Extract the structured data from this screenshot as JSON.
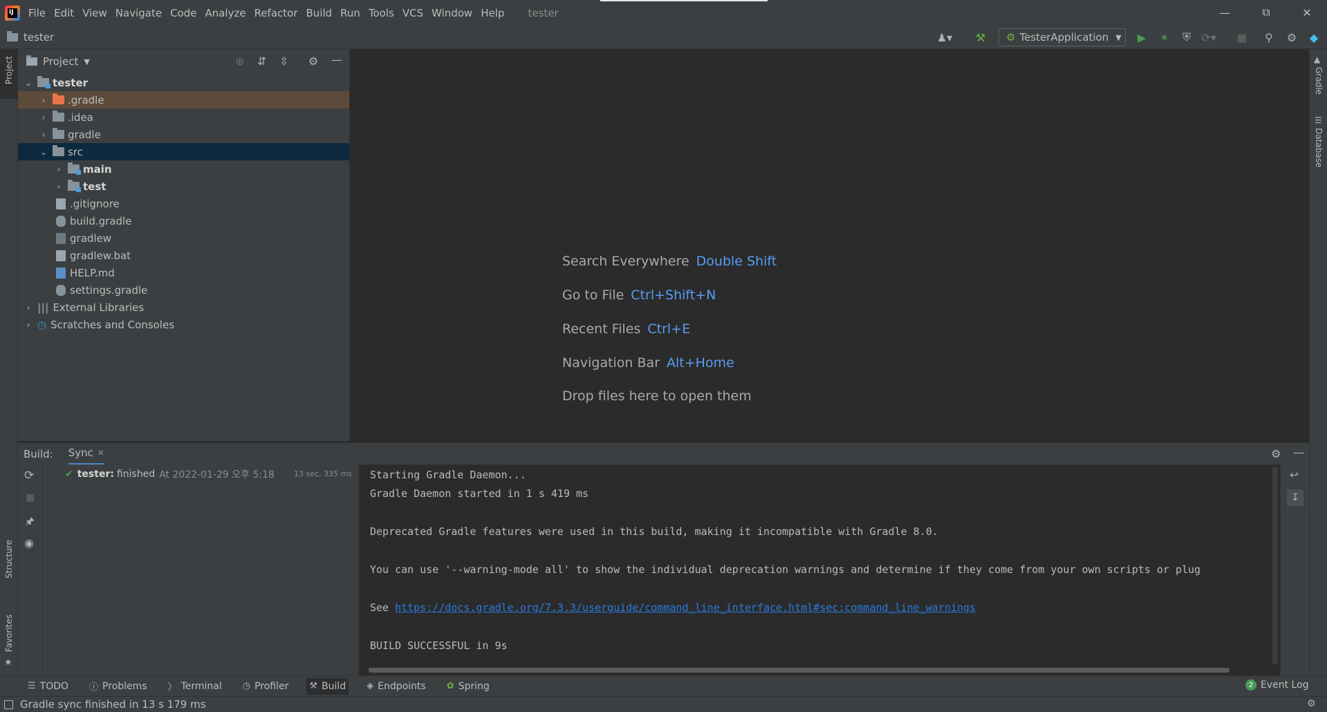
{
  "menubar": {
    "logo_text": "IJ",
    "items": [
      "File",
      "Edit",
      "View",
      "Navigate",
      "Code",
      "Analyze",
      "Refactor",
      "Build",
      "Run",
      "Tools",
      "VCS",
      "Window",
      "Help"
    ],
    "window_title": "tester",
    "window_controls": [
      "minimize-icon",
      "restore-icon",
      "close-icon"
    ]
  },
  "navbar": {
    "breadcrumb": "tester",
    "run_config": "TesterApplication",
    "icons": [
      "user-icon",
      "build-hammer-icon",
      "run-icon",
      "debug-icon",
      "coverage-icon",
      "profile-icon",
      "stop-icon",
      "search-icon",
      "settings-gear-icon",
      "jetbrains-toolbox-icon"
    ]
  },
  "left_stripe": {
    "project": "Project",
    "structure": "Structure",
    "favorites": "Favorites"
  },
  "right_stripe": {
    "gradle": "Gradle",
    "database": "Database"
  },
  "project_panel": {
    "title": "Project",
    "tree": [
      {
        "label": "tester",
        "level": 0,
        "type": "module",
        "expanded": true
      },
      {
        "label": ".gradle",
        "level": 1,
        "type": "folder-orange",
        "expanded": false
      },
      {
        "label": ".idea",
        "level": 1,
        "type": "folder",
        "expanded": false
      },
      {
        "label": "gradle",
        "level": 1,
        "type": "folder",
        "expanded": false
      },
      {
        "label": "src",
        "level": 1,
        "type": "folder",
        "expanded": true
      },
      {
        "label": "main",
        "level": 2,
        "type": "folder-source",
        "expanded": false
      },
      {
        "label": "test",
        "level": 2,
        "type": "folder-source",
        "expanded": false
      },
      {
        "label": ".gitignore",
        "level": 1,
        "type": "file"
      },
      {
        "label": "build.gradle",
        "level": 1,
        "type": "file-gradle"
      },
      {
        "label": "gradlew",
        "level": 1,
        "type": "file-shell"
      },
      {
        "label": "gradlew.bat",
        "level": 1,
        "type": "file"
      },
      {
        "label": "HELP.md",
        "level": 1,
        "type": "file-md"
      },
      {
        "label": "settings.gradle",
        "level": 1,
        "type": "file-gradle"
      },
      {
        "label": "External Libraries",
        "level": 0,
        "type": "libraries",
        "expanded": false
      },
      {
        "label": "Scratches and Consoles",
        "level": 0,
        "type": "scratches",
        "expanded": false
      }
    ]
  },
  "editor_hints": [
    {
      "text": "Search Everywhere",
      "shortcut": "Double Shift"
    },
    {
      "text": "Go to File",
      "shortcut": "Ctrl+Shift+N"
    },
    {
      "text": "Recent Files",
      "shortcut": "Ctrl+E"
    },
    {
      "text": "Navigation Bar",
      "shortcut": "Alt+Home"
    },
    {
      "text": "Drop files here to open them",
      "shortcut": ""
    }
  ],
  "build_panel": {
    "label": "Build:",
    "tab": "Sync",
    "result": {
      "name": "tester:",
      "status": "finished",
      "time": "At 2022-01-29 오후 5:18",
      "duration": "13 sec, 335 ms"
    },
    "console_lines": [
      "Starting Gradle Daemon...",
      "Gradle Daemon started in 1 s 419 ms",
      "",
      "Deprecated Gradle features were used in this build, making it incompatible with Gradle 8.0.",
      "",
      "You can use '--warning-mode all' to show the individual deprecation warnings and determine if they come from your own scripts or plug",
      "",
      "",
      "",
      "BUILD SUCCESSFUL in 9s"
    ],
    "see_prefix": "See ",
    "see_link": "https://docs.gradle.org/7.3.3/userguide/command_line_interface.html#sec:command_line_warnings"
  },
  "bottom_tools": [
    {
      "label": "TODO",
      "icon": "list-icon"
    },
    {
      "label": "Problems",
      "icon": "problems-icon"
    },
    {
      "label": "Terminal",
      "icon": "terminal-icon"
    },
    {
      "label": "Profiler",
      "icon": "profiler-icon"
    },
    {
      "label": "Build",
      "icon": "hammer-icon",
      "active": true
    },
    {
      "label": "Endpoints",
      "icon": "endpoints-icon"
    },
    {
      "label": "Spring",
      "icon": "spring-icon"
    }
  ],
  "event_log": {
    "count": "2",
    "label": "Event Log"
  },
  "status_text": "Gradle sync finished in 13 s 179 ms"
}
